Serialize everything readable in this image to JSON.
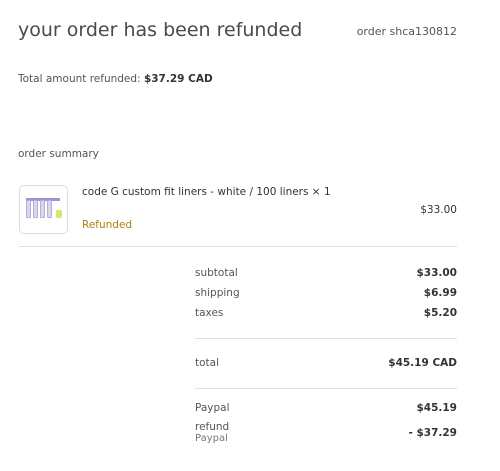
{
  "header": {
    "title": "your order has been refunded",
    "order_number": "order shca130812"
  },
  "refund": {
    "label": "Total amount refunded:",
    "amount": "$37.29 CAD"
  },
  "summary": {
    "heading": "order summary",
    "item": {
      "name": "code G custom fit liners - white / 100 liners × 1",
      "status": "Refunded",
      "price": "$33.00",
      "icon": "product-liners-image"
    },
    "subtotal_label": "subtotal",
    "subtotal_value": "$33.00",
    "shipping_label": "shipping",
    "shipping_value": "$6.99",
    "taxes_label": "taxes",
    "taxes_value": "$5.20",
    "total_label": "total",
    "total_value": "$45.19 CAD",
    "payment_label": "Paypal",
    "payment_value": "$45.19",
    "refund_label": "refund",
    "refund_method": "Paypal",
    "refund_value": "- $37.29"
  },
  "colors": {
    "refunded_status": "#b07d10",
    "divider": "#e1e1e1"
  }
}
